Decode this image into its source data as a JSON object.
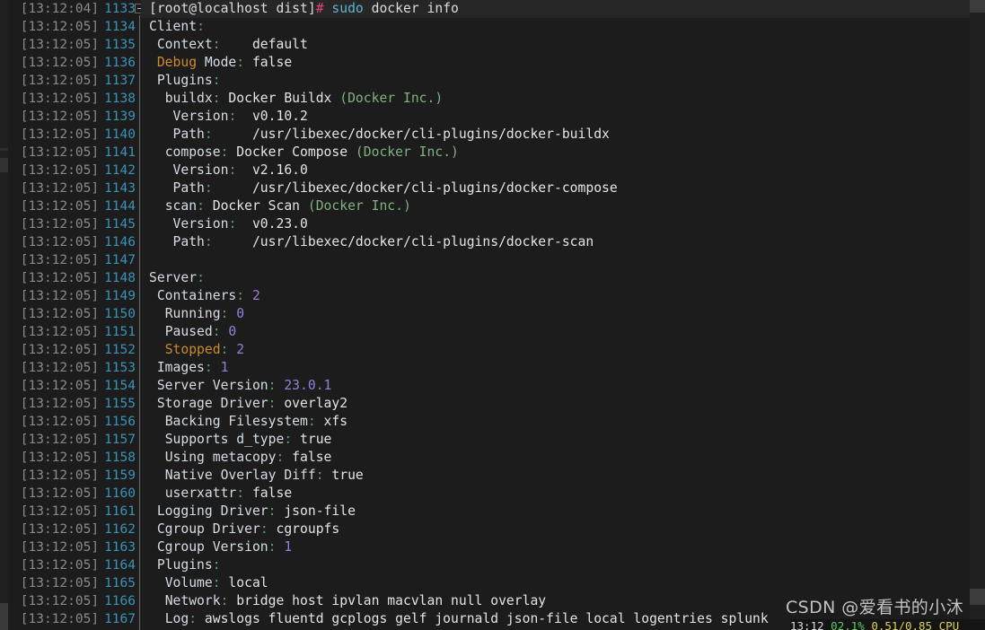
{
  "theme": {
    "background": "#1c1c1c",
    "prompt_row_background": "#262626",
    "gutter_timestamp_color": "#8a8a8a",
    "gutter_linenumber_color": "#3a93b8",
    "key_color": "#d4dde6",
    "colon_color": "#5f9e6e",
    "number_color": "#9a7ddb",
    "keyword_color": "#cc8a28",
    "paren_color": "#7fb07f",
    "command_color": "#5fb3d4",
    "hash_color": "#e0447f"
  },
  "prompt": {
    "user_host_path": "[root@localhost dist]",
    "hash": "#",
    "command_sudo": "sudo",
    "command_rest": " docker info"
  },
  "lines": [
    {
      "time": "[13:12:04]",
      "num": "1133",
      "fold": true,
      "kind": "prompt"
    },
    {
      "time": "[13:12:05]",
      "num": "1134",
      "indent": 0,
      "key": "Client",
      "colon": ":",
      "value": ""
    },
    {
      "time": "[13:12:05]",
      "num": "1135",
      "indent": 1,
      "key": "Context",
      "colon": ":",
      "value": "    default"
    },
    {
      "time": "[13:12:05]",
      "num": "1136",
      "indent": 1,
      "kw": "Debug",
      "key": " Mode",
      "colon": ":",
      "value": " false"
    },
    {
      "time": "[13:12:05]",
      "num": "1137",
      "indent": 1,
      "key": "Plugins",
      "colon": ":",
      "value": ""
    },
    {
      "time": "[13:12:05]",
      "num": "1138",
      "indent": 2,
      "key": "buildx",
      "colon": ":",
      "value": " Docker Buildx ",
      "paren": "(Docker Inc.)"
    },
    {
      "time": "[13:12:05]",
      "num": "1139",
      "indent": 3,
      "key": "Version",
      "colon": ":",
      "value": "  v0.10.2"
    },
    {
      "time": "[13:12:05]",
      "num": "1140",
      "indent": 3,
      "key": "Path",
      "colon": ":",
      "value": "     /usr/libexec/docker/cli-plugins/docker-buildx"
    },
    {
      "time": "[13:12:05]",
      "num": "1141",
      "indent": 2,
      "key": "compose",
      "colon": ":",
      "value": " Docker Compose ",
      "paren": "(Docker Inc.)"
    },
    {
      "time": "[13:12:05]",
      "num": "1142",
      "indent": 3,
      "key": "Version",
      "colon": ":",
      "value": "  v2.16.0"
    },
    {
      "time": "[13:12:05]",
      "num": "1143",
      "indent": 3,
      "key": "Path",
      "colon": ":",
      "value": "     /usr/libexec/docker/cli-plugins/docker-compose"
    },
    {
      "time": "[13:12:05]",
      "num": "1144",
      "indent": 2,
      "key": "scan",
      "colon": ":",
      "value": " Docker Scan ",
      "paren": "(Docker Inc.)"
    },
    {
      "time": "[13:12:05]",
      "num": "1145",
      "indent": 3,
      "key": "Version",
      "colon": ":",
      "value": "  v0.23.0"
    },
    {
      "time": "[13:12:05]",
      "num": "1146",
      "indent": 3,
      "key": "Path",
      "colon": ":",
      "value": "     /usr/libexec/docker/cli-plugins/docker-scan"
    },
    {
      "time": "[13:12:05]",
      "num": "1147",
      "indent": 0,
      "key": "",
      "colon": "",
      "value": ""
    },
    {
      "time": "[13:12:05]",
      "num": "1148",
      "indent": 0,
      "key": "Server",
      "colon": ":",
      "value": ""
    },
    {
      "time": "[13:12:05]",
      "num": "1149",
      "indent": 1,
      "key": "Containers",
      "colon": ":",
      "num_value": " 2"
    },
    {
      "time": "[13:12:05]",
      "num": "1150",
      "indent": 2,
      "key": "Running",
      "colon": ":",
      "num_value": " 0"
    },
    {
      "time": "[13:12:05]",
      "num": "1151",
      "indent": 2,
      "key": "Paused",
      "colon": ":",
      "num_value": " 0"
    },
    {
      "time": "[13:12:05]",
      "num": "1152",
      "indent": 2,
      "kw": "Stopped",
      "colon": ":",
      "num_value": " 2"
    },
    {
      "time": "[13:12:05]",
      "num": "1153",
      "indent": 1,
      "key": "Images",
      "colon": ":",
      "num_value": " 1"
    },
    {
      "time": "[13:12:05]",
      "num": "1154",
      "indent": 1,
      "key": "Server Version",
      "colon": ":",
      "num_value": " 23.0.1"
    },
    {
      "time": "[13:12:05]",
      "num": "1155",
      "indent": 1,
      "key": "Storage Driver",
      "colon": ":",
      "value": " overlay2"
    },
    {
      "time": "[13:12:05]",
      "num": "1156",
      "indent": 2,
      "key": "Backing Filesystem",
      "colon": ":",
      "value": " xfs"
    },
    {
      "time": "[13:12:05]",
      "num": "1157",
      "indent": 2,
      "key": "Supports d_type",
      "colon": ":",
      "value": " true"
    },
    {
      "time": "[13:12:05]",
      "num": "1158",
      "indent": 2,
      "key": "Using metacopy",
      "colon": ":",
      "value": " false"
    },
    {
      "time": "[13:12:05]",
      "num": "1159",
      "indent": 2,
      "key": "Native Overlay Diff",
      "colon": ":",
      "value": " true"
    },
    {
      "time": "[13:12:05]",
      "num": "1160",
      "indent": 2,
      "key": "userxattr",
      "colon": ":",
      "value": " false"
    },
    {
      "time": "[13:12:05]",
      "num": "1161",
      "indent": 1,
      "key": "Logging Driver",
      "colon": ":",
      "value": " json-file"
    },
    {
      "time": "[13:12:05]",
      "num": "1162",
      "indent": 1,
      "key": "Cgroup Driver",
      "colon": ":",
      "value": " cgroupfs"
    },
    {
      "time": "[13:12:05]",
      "num": "1163",
      "indent": 1,
      "key": "Cgroup Version",
      "colon": ":",
      "num_value": " 1"
    },
    {
      "time": "[13:12:05]",
      "num": "1164",
      "indent": 1,
      "key": "Plugins",
      "colon": ":",
      "value": ""
    },
    {
      "time": "[13:12:05]",
      "num": "1165",
      "indent": 2,
      "key": "Volume",
      "colon": ":",
      "value": " local"
    },
    {
      "time": "[13:12:05]",
      "num": "1166",
      "indent": 2,
      "key": "Network",
      "colon": ":",
      "value": " bridge host ipvlan macvlan null overlay"
    },
    {
      "time": "[13:12:05]",
      "num": "1167",
      "indent": 2,
      "key": "Log",
      "colon": ":",
      "value": " awslogs fluentd gcplogs gelf journald json-file local logentries splunk"
    }
  ],
  "watermark": {
    "text": "CSDN @爱看书的小沐"
  },
  "status_strip": {
    "time": "13:12",
    "percent": "02.1%",
    "load": "0.51/0.85 CPU"
  }
}
